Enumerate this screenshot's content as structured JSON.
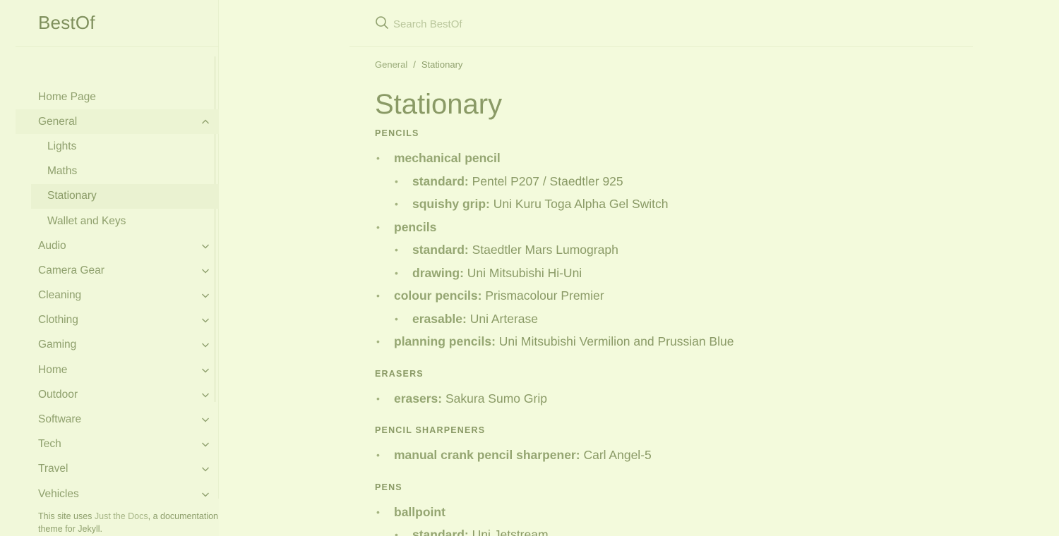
{
  "site": {
    "title": "BestOf"
  },
  "search": {
    "placeholder": "Search BestOf"
  },
  "sidebar": {
    "items": [
      {
        "label": "Home Page"
      },
      {
        "label": "General"
      },
      {
        "label": "Lights"
      },
      {
        "label": "Maths"
      },
      {
        "label": "Stationary"
      },
      {
        "label": "Wallet and Keys"
      },
      {
        "label": "Audio"
      },
      {
        "label": "Camera Gear"
      },
      {
        "label": "Cleaning"
      },
      {
        "label": "Clothing"
      },
      {
        "label": "Gaming"
      },
      {
        "label": "Home"
      },
      {
        "label": "Outdoor"
      },
      {
        "label": "Software"
      },
      {
        "label": "Tech"
      },
      {
        "label": "Travel"
      },
      {
        "label": "Vehicles"
      }
    ],
    "footer": {
      "prefix": "This site uses ",
      "link": "Just the Docs",
      "suffix": ", a documentation theme for Jekyll."
    }
  },
  "breadcrumb": {
    "parent": "General",
    "separator": "/",
    "current": "Stationary"
  },
  "page": {
    "title": "Stationary"
  },
  "sections": {
    "pencils": {
      "heading": "PENCILS",
      "mechanical": "mechanical pencil",
      "mech_standard_k": "standard:",
      "mech_standard_v": "Pentel P207 / Staedtler 925",
      "mech_squishy_k": "squishy grip:",
      "mech_squishy_v": "Uni Kuru Toga Alpha Gel Switch",
      "pencils": "pencils",
      "p_standard_k": "standard:",
      "p_standard_v": "Staedtler Mars Lumograph",
      "p_drawing_k": "drawing:",
      "p_drawing_v": "Uni Mitsubishi Hi-Uni",
      "colour_k": "colour pencils:",
      "colour_v": "Prismacolour Premier",
      "erasable_k": "erasable:",
      "erasable_v": "Uni Arterase",
      "planning_k": "planning pencils:",
      "planning_v": "Uni Mitsubishi Vermilion and Prussian Blue"
    },
    "erasers": {
      "heading": "ERASERS",
      "erasers_k": "erasers:",
      "erasers_v": "Sakura Sumo Grip"
    },
    "sharpeners": {
      "heading": "PENCIL SHARPENERS",
      "crank_k": "manual crank pencil sharpener:",
      "crank_v": "Carl Angel-5"
    },
    "pens": {
      "heading": "PENS",
      "ballpoint": "ballpoint",
      "bp_standard_k": "standard:",
      "bp_standard_v": "Uni Jetstream"
    }
  },
  "colors": {
    "background": "#f3fadc",
    "text": "#8fa06d",
    "muted": "#b9c69b"
  }
}
